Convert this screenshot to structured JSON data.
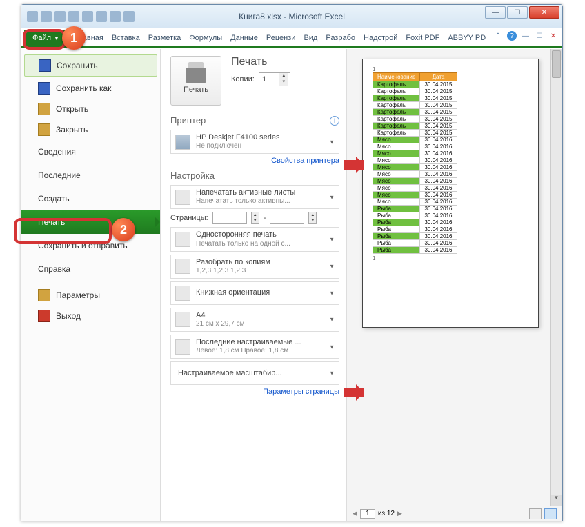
{
  "window": {
    "title": "Книга8.xlsx - Microsoft Excel"
  },
  "ribbon": {
    "file_tab": "Файл",
    "tabs": [
      "Главная",
      "Вставка",
      "Разметка",
      "Формулы",
      "Данные",
      "Рецензи",
      "Вид",
      "Разрабо",
      "Надстрой",
      "Foxit PDF",
      "ABBYY PD"
    ]
  },
  "backstage_nav": {
    "save": "Сохранить",
    "save_as": "Сохранить как",
    "open": "Открыть",
    "close": "Закрыть",
    "info": "Сведения",
    "recent": "Последние",
    "new": "Создать",
    "print": "Печать",
    "save_send": "Сохранить и отправить",
    "help": "Справка",
    "options": "Параметры",
    "exit": "Выход"
  },
  "print": {
    "title": "Печать",
    "button": "Печать",
    "copies_label": "Копии:",
    "copies_value": "1",
    "printer_section": "Принтер",
    "printer_name": "HP Deskjet F4100 series",
    "printer_status": "Не подключен",
    "printer_props": "Свойства принтера",
    "settings_section": "Настройка",
    "active_sheets": "Напечатать активные листы",
    "active_sheets_sub": "Напечатать только активны...",
    "pages_label": "Страницы:",
    "pages_to": "-",
    "one_sided": "Односторонняя печать",
    "one_sided_sub": "Печатать только на одной с...",
    "collate": "Разобрать по копиям",
    "collate_sub": "1,2,3   1,2,3   1,2,3",
    "orientation": "Книжная ориентация",
    "paper": "A4",
    "paper_sub": "21 см x 29,7 см",
    "margins": "Последние настраиваемые ...",
    "margins_sub": "Левое: 1,8 см   Правое: 1,8 см",
    "scaling": "Настраиваемое масштабир...",
    "page_setup": "Параметры страницы"
  },
  "preview": {
    "page_indicator_top": "1",
    "page_indicator_bottom": "1",
    "headers": [
      "Наименование",
      "Дата"
    ],
    "rows": [
      {
        "n": "Картофель",
        "d": "30.04.2015"
      },
      {
        "n": "Картофель",
        "d": "30.04.2015"
      },
      {
        "n": "Картофель",
        "d": "30.04.2015"
      },
      {
        "n": "Картофель",
        "d": "30.04.2015"
      },
      {
        "n": "Картофель",
        "d": "30.04.2015"
      },
      {
        "n": "Картофель",
        "d": "30.04.2015"
      },
      {
        "n": "Картофель",
        "d": "30.04.2015"
      },
      {
        "n": "Картофель",
        "d": "30.04.2015"
      },
      {
        "n": "Мясо",
        "d": "30.04.2016"
      },
      {
        "n": "Мясо",
        "d": "30.04.2016"
      },
      {
        "n": "Мясо",
        "d": "30.04.2016"
      },
      {
        "n": "Мясо",
        "d": "30.04.2016"
      },
      {
        "n": "Мясо",
        "d": "30.04.2016"
      },
      {
        "n": "Мясо",
        "d": "30.04.2016"
      },
      {
        "n": "Мясо",
        "d": "30.04.2016"
      },
      {
        "n": "Мясо",
        "d": "30.04.2016"
      },
      {
        "n": "Мясо",
        "d": "30.04.2016"
      },
      {
        "n": "Мясо",
        "d": "30.04.2016"
      },
      {
        "n": "Рыба",
        "d": "30.04.2016"
      },
      {
        "n": "Рыба",
        "d": "30.04.2016"
      },
      {
        "n": "Рыба",
        "d": "30.04.2016"
      },
      {
        "n": "Рыба",
        "d": "30.04.2016"
      },
      {
        "n": "Рыба",
        "d": "30.04.2016"
      },
      {
        "n": "Рыба",
        "d": "30.04.2016"
      },
      {
        "n": "Рыба",
        "d": "30.04.2016"
      }
    ],
    "footer_current": "1",
    "footer_total": "из 12"
  },
  "callouts": {
    "one": "1",
    "two": "2"
  }
}
